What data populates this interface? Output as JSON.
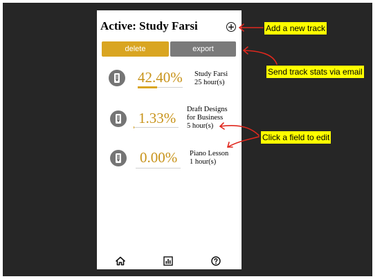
{
  "header": {
    "title": "Active: Study Farsi",
    "add_icon": "plus-circle-icon"
  },
  "toolbar": {
    "delete_label": "delete",
    "export_label": "export"
  },
  "tracks": [
    {
      "percent": "42.40%",
      "progress": 0.424,
      "name_lines": [
        "Study Farsi"
      ],
      "hours": "25 hour(s)"
    },
    {
      "percent": "1.33%",
      "progress": 0.0133,
      "name_lines": [
        "Draft Designs",
        "for Business"
      ],
      "hours": "5 hour(s)"
    },
    {
      "percent": "0.00%",
      "progress": 0.0,
      "name_lines": [
        "Piano Lesson"
      ],
      "hours": "1 hour(s)"
    }
  ],
  "bottom_nav": {
    "icons": [
      "home-icon",
      "bar-chart-icon",
      "help-icon"
    ]
  },
  "annotations": {
    "add_track": "Add a new track",
    "send_stats": "Send track stats via email",
    "edit_field": "Click a field to edit"
  },
  "colors": {
    "accent": "#d9a521",
    "percent_text": "#c8931a",
    "export_button": "#7a7a7a",
    "icon_gray": "#757575",
    "callout_bg": "#ffff00",
    "arrow": "#e0281e"
  }
}
